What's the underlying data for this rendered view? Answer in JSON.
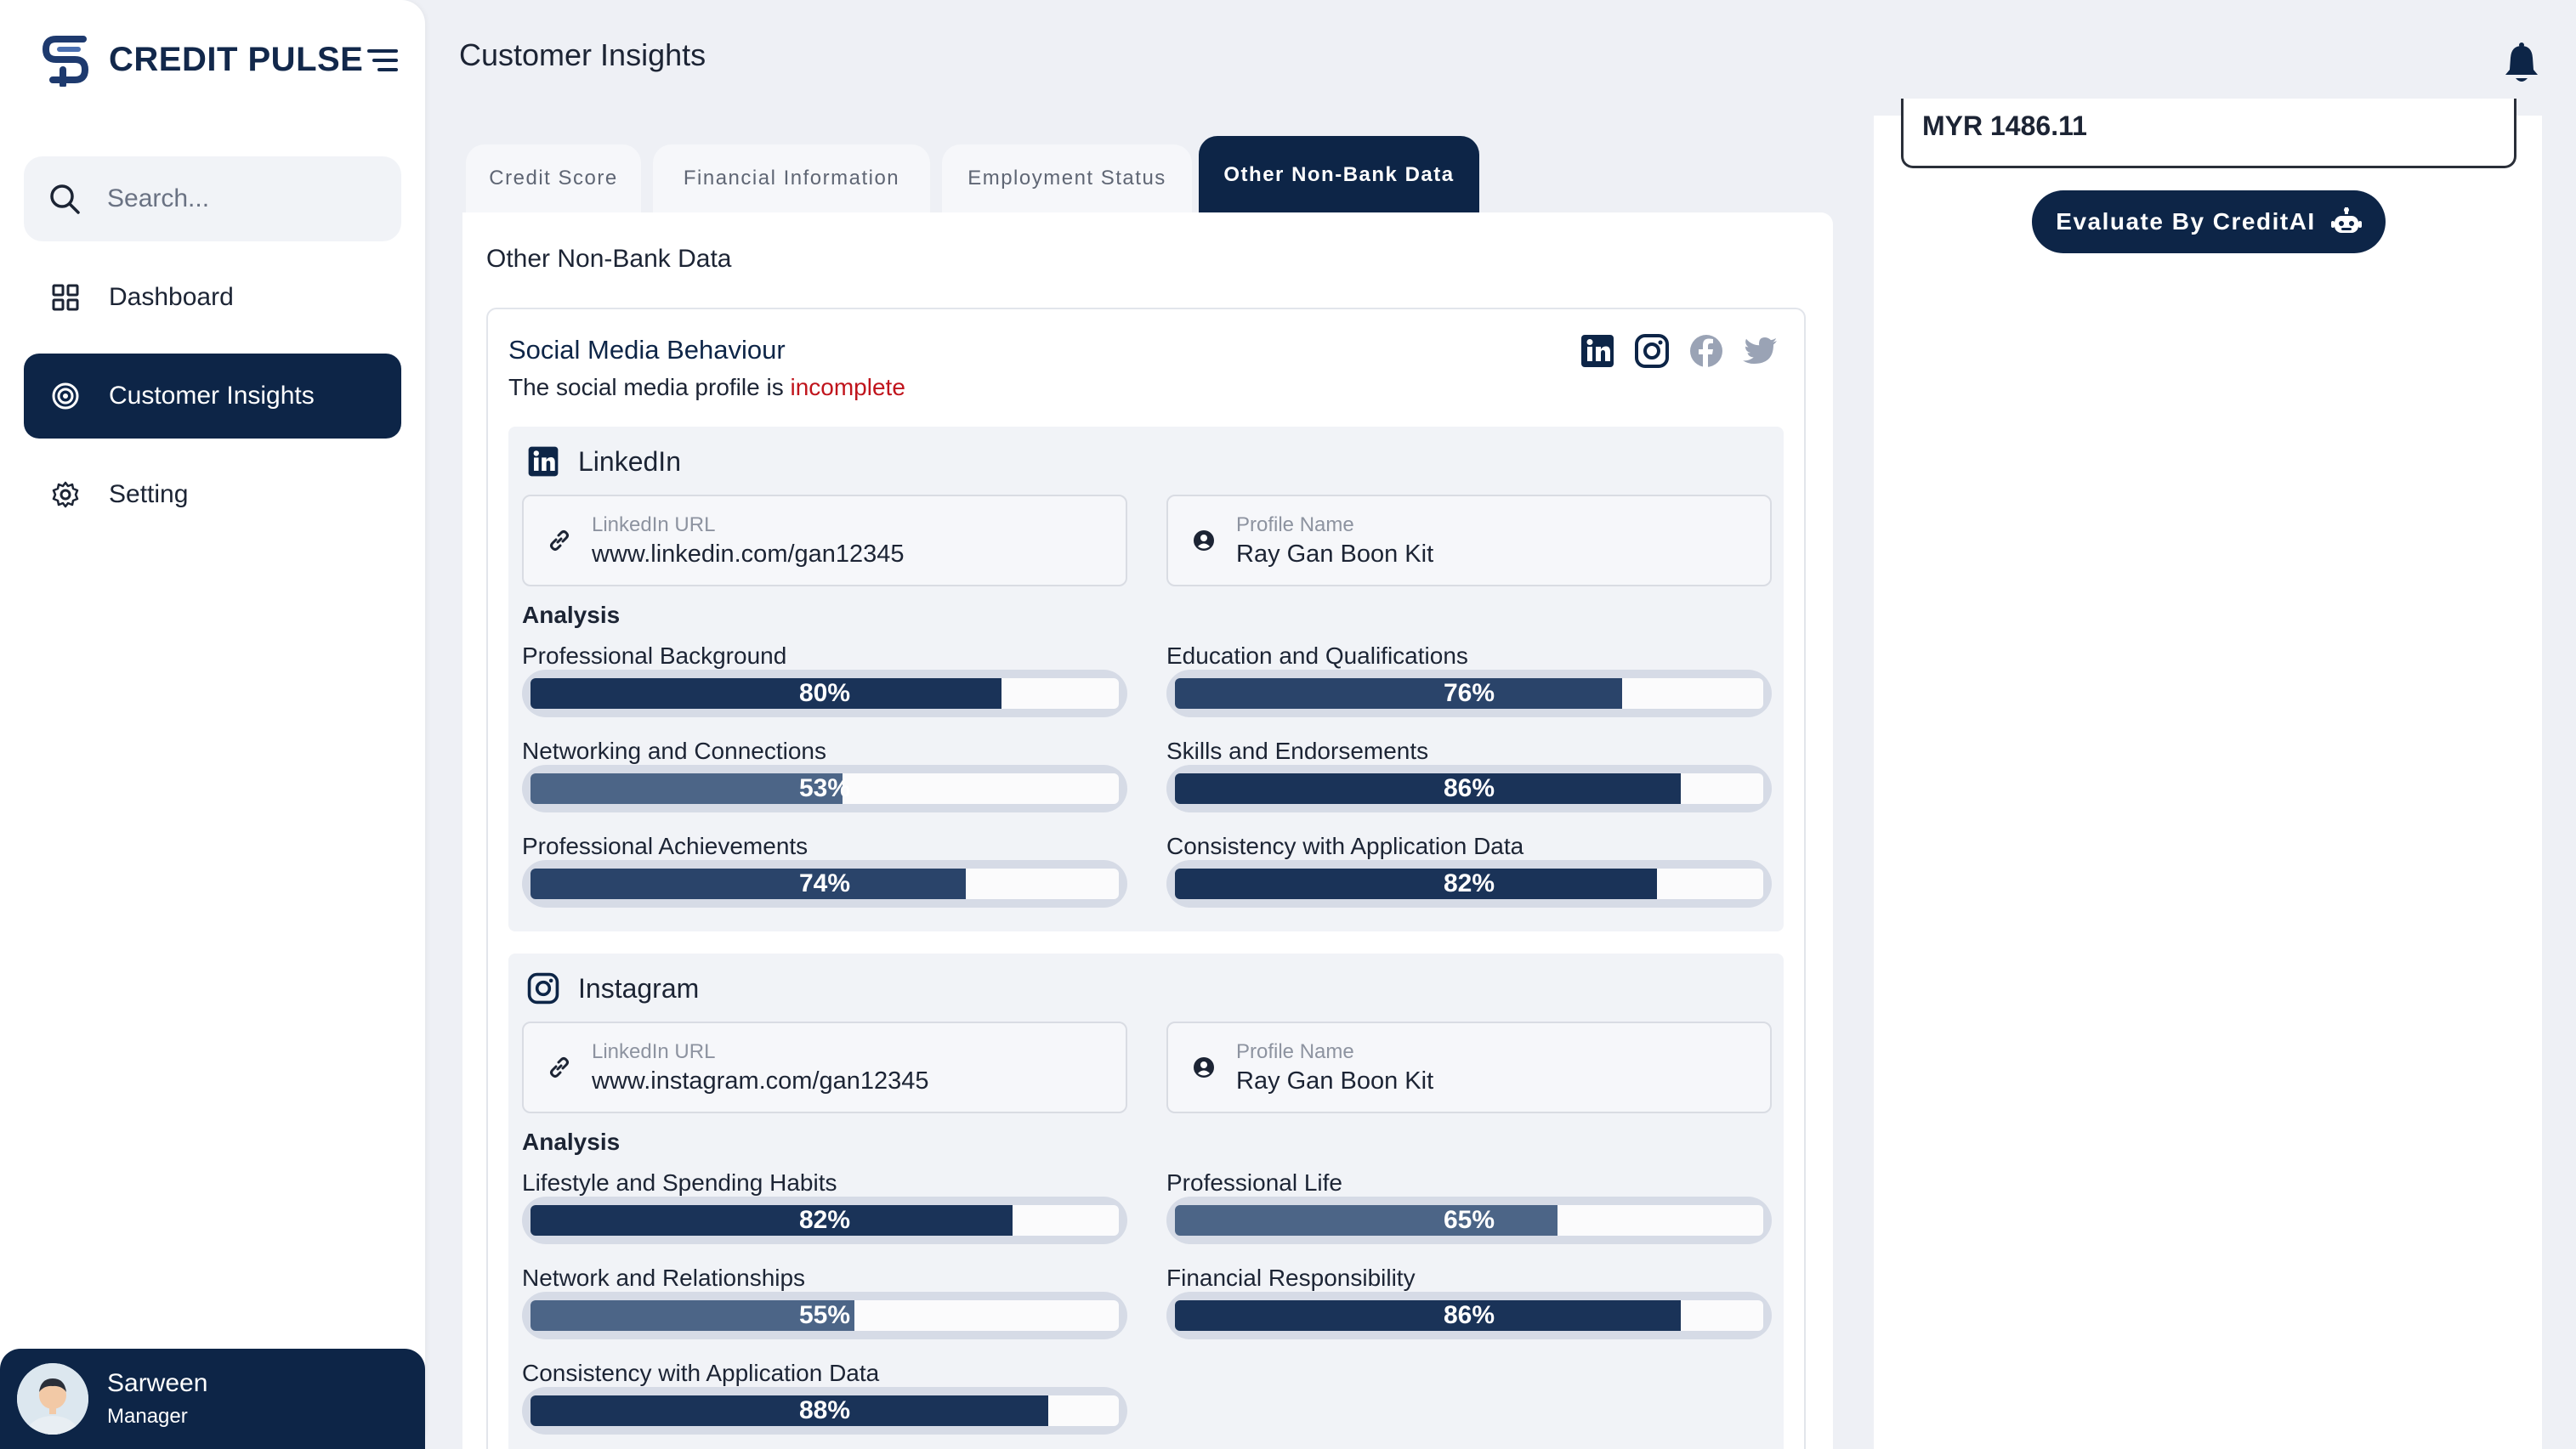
{
  "brand": {
    "name": "CREDIT PULSE"
  },
  "search": {
    "placeholder": "Search..."
  },
  "nav": [
    {
      "label": "Dashboard",
      "icon": "grid-icon",
      "active": false
    },
    {
      "label": "Customer Insights",
      "icon": "target-icon",
      "active": true
    },
    {
      "label": "Setting",
      "icon": "gear-icon",
      "active": false
    }
  ],
  "user": {
    "name": "Sarween",
    "role": "Manager"
  },
  "header": {
    "title": "Customer Insights"
  },
  "tabs": [
    "Credit Score",
    "Financial Information",
    "Employment Status",
    "Other Non-Bank Data"
  ],
  "main": {
    "heading": "Other Non-Bank Data",
    "social": {
      "title": "Social Media Behaviour",
      "subtitle_prefix": "The social media profile is ",
      "status": "incomplete",
      "icons": [
        "linkedin-icon",
        "instagram-icon",
        "facebook-icon",
        "twitter-icon"
      ]
    },
    "linkedin": {
      "name": "LinkedIn",
      "url_label": "LinkedIn URL",
      "url": "www.linkedin.com/gan12345",
      "profile_label": "Profile Name",
      "profile": "Ray Gan Boon Kit",
      "analysis_label": "Analysis",
      "metrics": [
        {
          "label": "Professional Background",
          "value": "80%",
          "pct": 80
        },
        {
          "label": "Education and Qualifications",
          "value": "76%",
          "pct": 76
        },
        {
          "label": "Networking and Connections",
          "value": "53%",
          "pct": 53
        },
        {
          "label": "Skills and Endorsements",
          "value": "86%",
          "pct": 86
        },
        {
          "label": "Professional Achievements",
          "value": "74%",
          "pct": 74
        },
        {
          "label": "Consistency with Application Data",
          "value": "82%",
          "pct": 82
        }
      ]
    },
    "instagram": {
      "name": "Instagram",
      "url_label": "LinkedIn URL",
      "url": "www.instagram.com/gan12345",
      "profile_label": "Profile Name",
      "profile": "Ray Gan Boon Kit",
      "analysis_label": "Analysis",
      "metrics": [
        {
          "label": "Lifestyle and Spending Habits",
          "value": "82%",
          "pct": 82
        },
        {
          "label": "Professional Life",
          "value": "65%",
          "pct": 65
        },
        {
          "label": "Network and Relationships",
          "value": "55%",
          "pct": 55
        },
        {
          "label": "Financial Responsibility",
          "value": "86%",
          "pct": 86
        },
        {
          "label": "Consistency with Application Data",
          "value": "88%",
          "pct": 88
        }
      ]
    }
  },
  "right": {
    "amount": "MYR 1486.11",
    "evaluate_label": "Evaluate By CreditAI"
  },
  "colors": {
    "primary": "#0d2547",
    "bar": "#1a3358",
    "bar_light": "#4c6587",
    "status_red": "#c0141c"
  }
}
